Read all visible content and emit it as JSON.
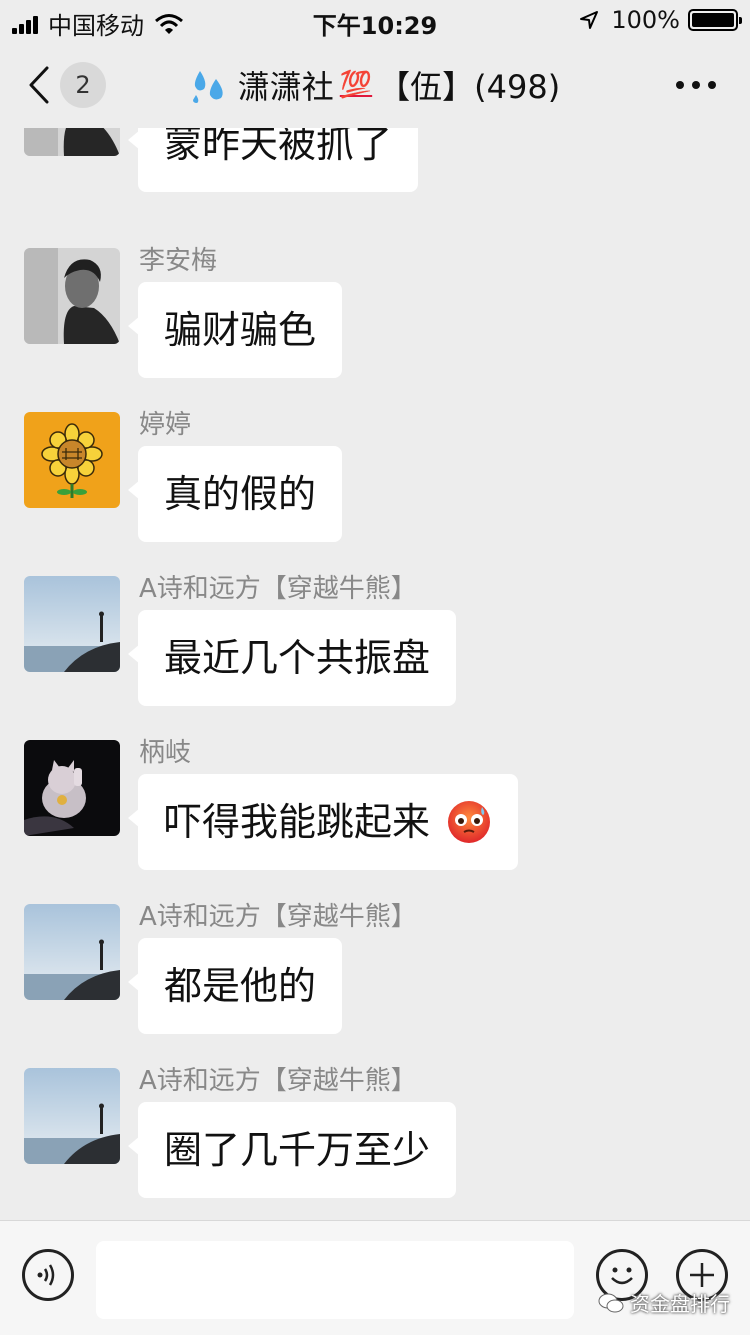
{
  "status_bar": {
    "carrier": "中国移动",
    "time": "下午10:29",
    "battery_percent": "100%"
  },
  "nav": {
    "back_badge": "2",
    "group_name": "潇潇社",
    "group_suffix": "【伍】(498)",
    "icons": [
      "back-chevron-icon",
      "sweat-droplets-icon",
      "hundred-points-icon",
      "more-icon"
    ]
  },
  "messages": [
    {
      "sender": "",
      "text": "蒙昨天被抓了",
      "avatar": "man-portrait"
    },
    {
      "sender": "李安梅",
      "text": "骗财骗色",
      "avatar": "man-portrait"
    },
    {
      "sender": "婷婷",
      "text": "真的假的",
      "avatar": "sunflower"
    },
    {
      "sender": "A诗和远方【穿越牛熊】",
      "text": "最近几个共振盘",
      "avatar": "seaside-silhouette"
    },
    {
      "sender": "柄岐",
      "text": "吓得我能跳起来",
      "avatar": "lucky-cat-night",
      "emoji": "flushed-face"
    },
    {
      "sender": "A诗和远方【穿越牛熊】",
      "text": "都是他的",
      "avatar": "seaside-silhouette"
    },
    {
      "sender": "A诗和远方【穿越牛熊】",
      "text": "圈了几千万至少",
      "avatar": "seaside-silhouette"
    }
  ],
  "input_bar": {
    "placeholder": "",
    "watermark": "资金盘排行"
  },
  "colors": {
    "background": "#ededed",
    "bubble": "#ffffff",
    "sender_text": "#888888",
    "avatar_sunflower_bg": "#f0a21a"
  }
}
